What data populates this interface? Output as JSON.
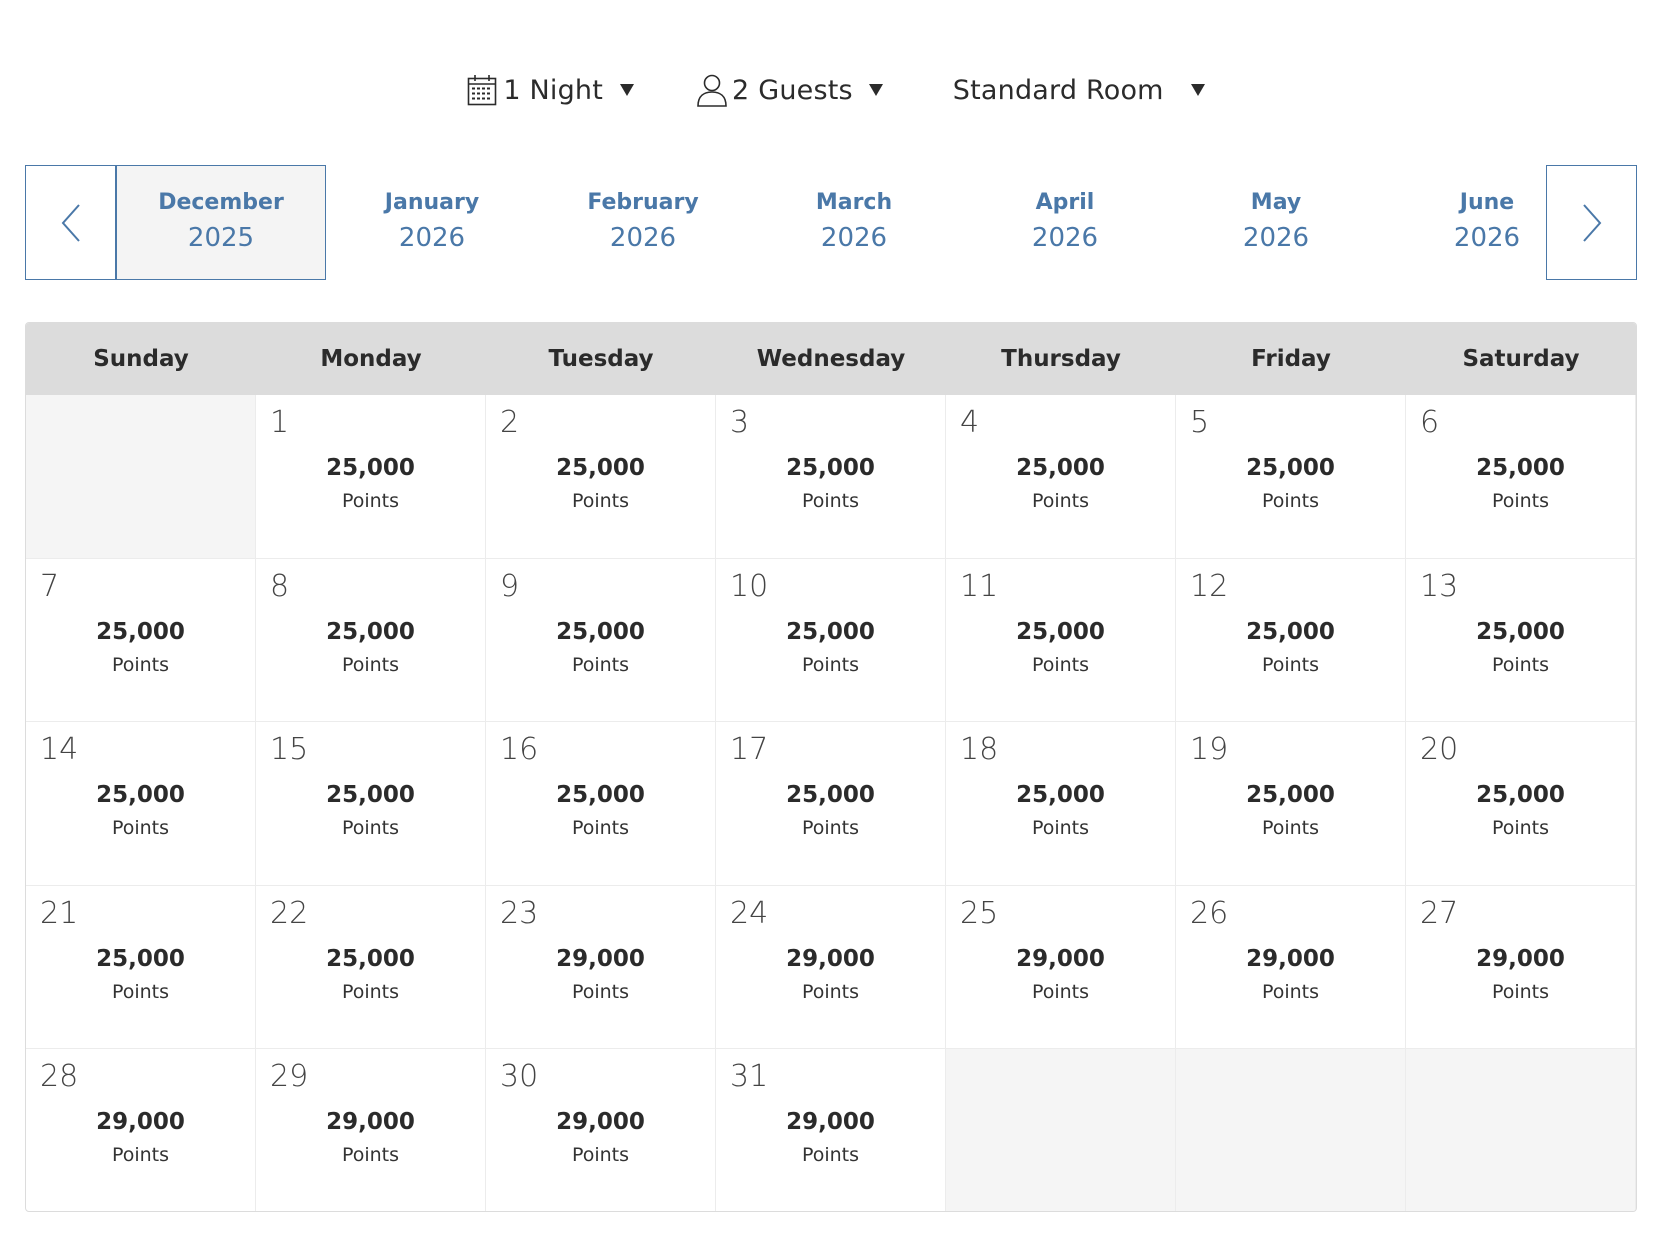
{
  "filters": {
    "nights": {
      "label": "1 Night",
      "icon": "calendar-icon"
    },
    "guests": {
      "label": "2 Guests",
      "icon": "person-icon"
    },
    "room": {
      "label": "Standard Room"
    }
  },
  "months": [
    {
      "name": "December",
      "year": "2025",
      "active": true
    },
    {
      "name": "January",
      "year": "2026",
      "active": false
    },
    {
      "name": "February",
      "year": "2026",
      "active": false
    },
    {
      "name": "March",
      "year": "2026",
      "active": false
    },
    {
      "name": "April",
      "year": "2026",
      "active": false
    },
    {
      "name": "May",
      "year": "2026",
      "active": false
    },
    {
      "name": "June",
      "year": "2026",
      "active": false
    }
  ],
  "calendar": {
    "weekdays": [
      "Sunday",
      "Monday",
      "Tuesday",
      "Wednesday",
      "Thursday",
      "Friday",
      "Saturday"
    ],
    "unit_label": "Points",
    "days": [
      null,
      {
        "day": "1",
        "points": "25,000"
      },
      {
        "day": "2",
        "points": "25,000"
      },
      {
        "day": "3",
        "points": "25,000"
      },
      {
        "day": "4",
        "points": "25,000"
      },
      {
        "day": "5",
        "points": "25,000"
      },
      {
        "day": "6",
        "points": "25,000"
      },
      {
        "day": "7",
        "points": "25,000"
      },
      {
        "day": "8",
        "points": "25,000"
      },
      {
        "day": "9",
        "points": "25,000"
      },
      {
        "day": "10",
        "points": "25,000"
      },
      {
        "day": "11",
        "points": "25,000"
      },
      {
        "day": "12",
        "points": "25,000"
      },
      {
        "day": "13",
        "points": "25,000"
      },
      {
        "day": "14",
        "points": "25,000"
      },
      {
        "day": "15",
        "points": "25,000"
      },
      {
        "day": "16",
        "points": "25,000"
      },
      {
        "day": "17",
        "points": "25,000"
      },
      {
        "day": "18",
        "points": "25,000"
      },
      {
        "day": "19",
        "points": "25,000"
      },
      {
        "day": "20",
        "points": "25,000"
      },
      {
        "day": "21",
        "points": "25,000"
      },
      {
        "day": "22",
        "points": "25,000"
      },
      {
        "day": "23",
        "points": "29,000"
      },
      {
        "day": "24",
        "points": "29,000"
      },
      {
        "day": "25",
        "points": "29,000"
      },
      {
        "day": "26",
        "points": "29,000"
      },
      {
        "day": "27",
        "points": "29,000"
      },
      {
        "day": "28",
        "points": "29,000"
      },
      {
        "day": "29",
        "points": "29,000"
      },
      {
        "day": "30",
        "points": "29,000"
      },
      {
        "day": "31",
        "points": "29,000"
      },
      null,
      null,
      null
    ]
  },
  "colors": {
    "accent": "#4a78a8",
    "header_bg": "#dcdcdc",
    "empty_cell": "#f5f5f5",
    "active_tab_bg": "#f4f4f4"
  }
}
